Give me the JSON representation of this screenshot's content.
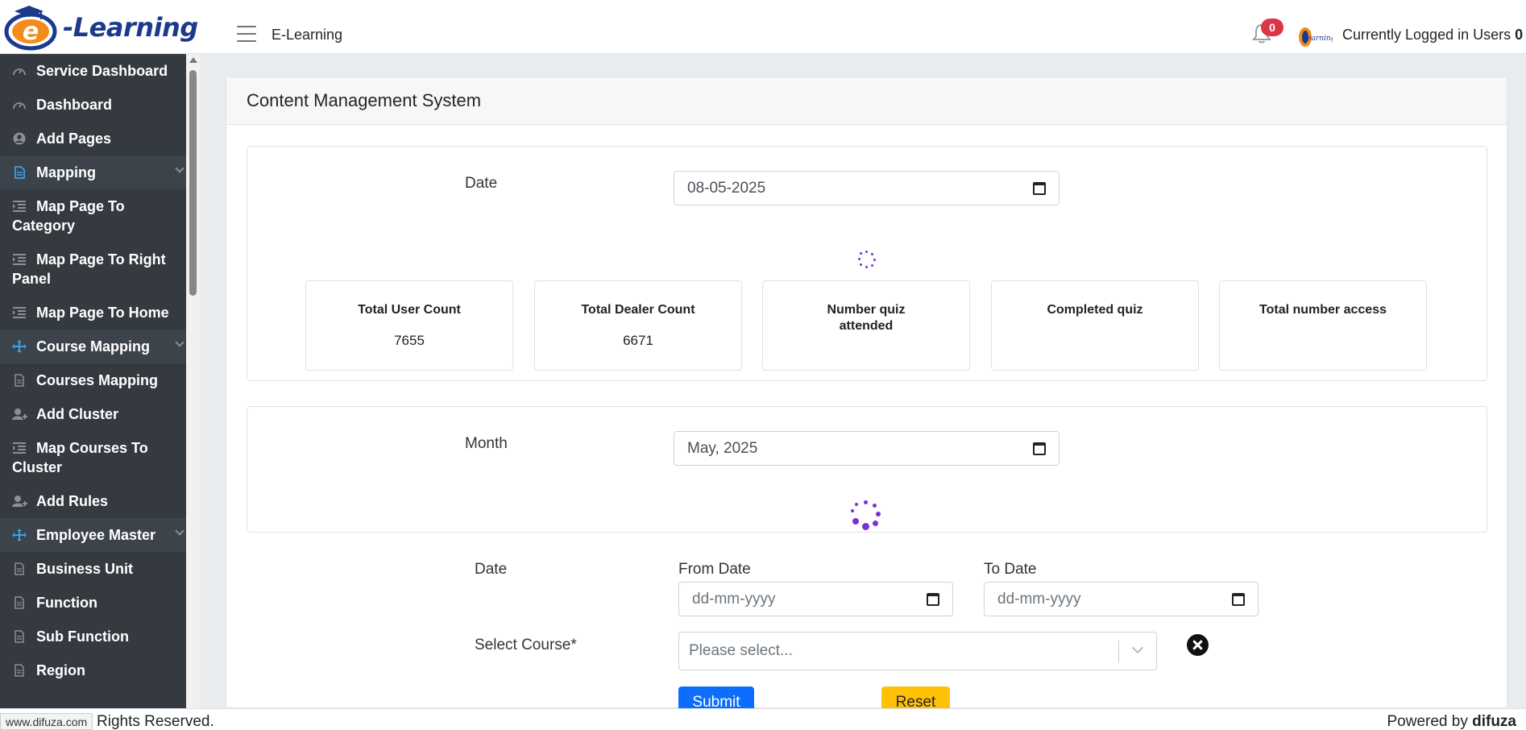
{
  "header": {
    "logo_text": "-Learning",
    "logo_letter": "e",
    "brand": "E-Learning",
    "notification_count": "0",
    "logged_label": "Currently Logged in Users",
    "logged_count": "0"
  },
  "sidebar": {
    "items": [
      {
        "label": "Service Dashboard",
        "icon": "gauge-icon",
        "group": false
      },
      {
        "label": "Dashboard",
        "icon": "gauge-icon",
        "group": false
      },
      {
        "label": "Add Pages",
        "icon": "user-circle-icon",
        "group": false
      },
      {
        "label": "Mapping",
        "icon": "document-icon",
        "group": true
      },
      {
        "label": "Map Page To Category",
        "icon": "indent-icon",
        "group": false
      },
      {
        "label": "Map Page To Right Panel",
        "icon": "indent-icon",
        "group": false
      },
      {
        "label": "Map Page To Home",
        "icon": "indent-icon",
        "group": false
      },
      {
        "label": "Course Mapping",
        "icon": "arrows-move-icon",
        "group": true
      },
      {
        "label": "Courses Mapping",
        "icon": "file-icon",
        "group": false
      },
      {
        "label": "Add Cluster",
        "icon": "user-plus-icon",
        "group": false
      },
      {
        "label": "Map Courses To Cluster",
        "icon": "indent-icon",
        "group": false
      },
      {
        "label": "Add Rules",
        "icon": "user-plus-icon",
        "group": false
      },
      {
        "label": "Employee Master",
        "icon": "arrows-move-icon",
        "group": true
      },
      {
        "label": "Business Unit",
        "icon": "file-icon",
        "group": false
      },
      {
        "label": "Function",
        "icon": "file-icon",
        "group": false
      },
      {
        "label": "Sub Function",
        "icon": "file-icon",
        "group": false
      },
      {
        "label": "Region",
        "icon": "file-icon",
        "group": false
      }
    ]
  },
  "content": {
    "title": "Content Management System",
    "date_section": {
      "label": "Date",
      "value": "08-05-2025"
    },
    "stats": [
      {
        "title": "Total User Count",
        "value": "7655"
      },
      {
        "title": "Total Dealer Count",
        "value": "6671"
      },
      {
        "title": "Number quiz attended",
        "value": ""
      },
      {
        "title": "Completed quiz",
        "value": ""
      },
      {
        "title": "Total number access",
        "value": ""
      }
    ],
    "month_section": {
      "label": "Month",
      "value": "May, 2025"
    },
    "filter": {
      "date_label": "Date",
      "from_label": "From Date",
      "from_placeholder": "dd-mm-yyyy",
      "to_label": "To Date",
      "to_placeholder": "dd-mm-yyyy",
      "course_label": "Select Course*",
      "course_placeholder": "Please select...",
      "submit": "Submit",
      "reset": "Reset"
    }
  },
  "footer": {
    "left": "Rights Reserved.",
    "right_prefix": "Powered by",
    "right_brand": "difuza",
    "url_tip": "www.difuza.com"
  },
  "colors": {
    "sidebar_bg": "#343a40",
    "accent_icon": "#3aa0e8",
    "spinner": "#7b2fd8",
    "primary": "#0d6efd",
    "warning": "#ffc107",
    "badge": "#dc3545"
  }
}
